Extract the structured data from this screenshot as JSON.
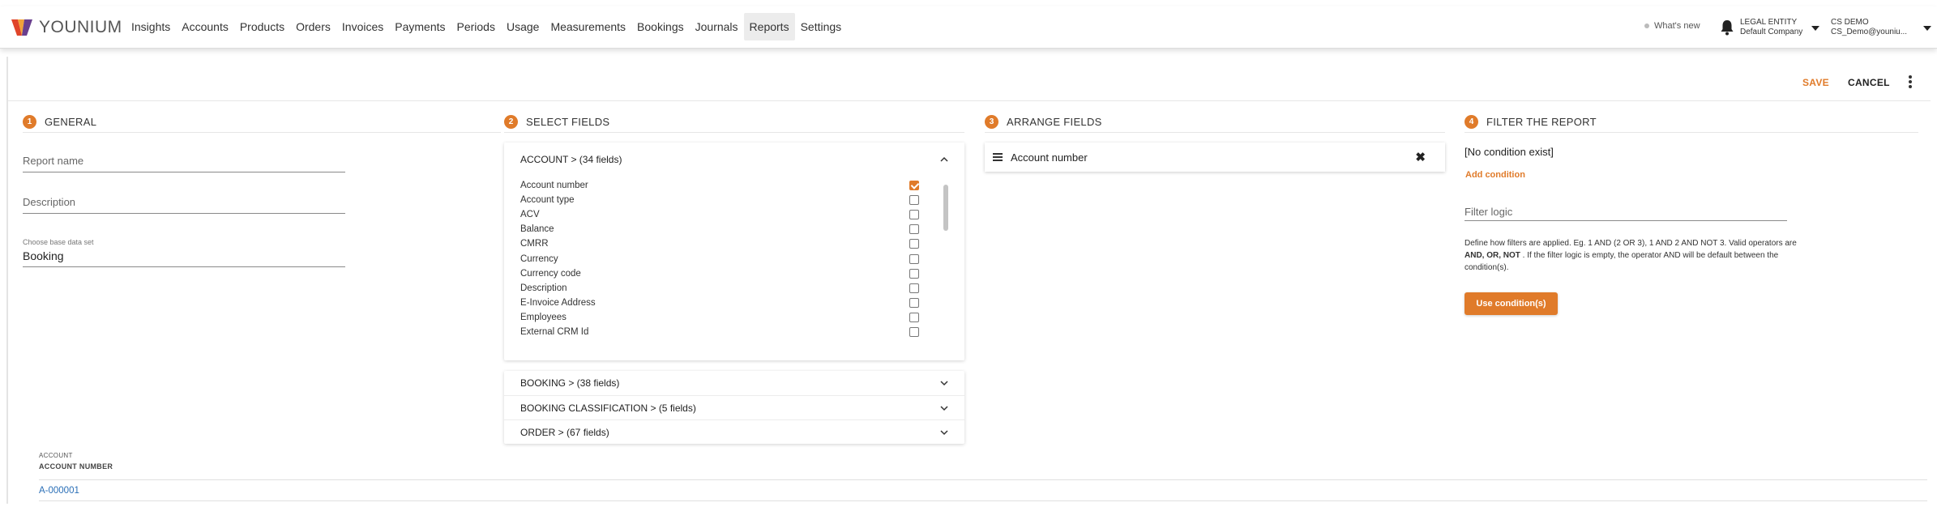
{
  "brand": {
    "logo_text": "YOUNIUM"
  },
  "nav": {
    "items": [
      "Insights",
      "Accounts",
      "Products",
      "Orders",
      "Invoices",
      "Payments",
      "Periods",
      "Usage",
      "Measurements",
      "Bookings",
      "Journals",
      "Reports",
      "Settings"
    ],
    "active": "Reports",
    "whats_new": "What's new",
    "legal_entity_label": "LEGAL ENTITY",
    "legal_entity_value": "Default Company",
    "user_name": "CS DEMO",
    "user_email": "CS_Demo@youniu..."
  },
  "toolbar": {
    "save_label": "SAVE",
    "cancel_label": "CANCEL"
  },
  "sections": {
    "general": {
      "step": "1",
      "title": "GENERAL"
    },
    "select": {
      "step": "2",
      "title": "SELECT FIELDS"
    },
    "arrange": {
      "step": "3",
      "title": "ARRANGE FIELDS"
    },
    "filter": {
      "step": "4",
      "title": "FILTER THE REPORT"
    }
  },
  "general": {
    "report_name_placeholder": "Report name",
    "description_placeholder": "Description",
    "base_data_set_label": "Choose base data set",
    "base_data_set_value": "Booking"
  },
  "select_fields": {
    "account_group": "ACCOUNT >  (34 fields)",
    "fields": [
      {
        "label": "Account number",
        "checked": true
      },
      {
        "label": "Account type",
        "checked": false
      },
      {
        "label": "ACV",
        "checked": false
      },
      {
        "label": "Balance",
        "checked": false
      },
      {
        "label": "CMRR",
        "checked": false
      },
      {
        "label": "Currency",
        "checked": false
      },
      {
        "label": "Currency code",
        "checked": false
      },
      {
        "label": "Description",
        "checked": false
      },
      {
        "label": "E-Invoice Address",
        "checked": false
      },
      {
        "label": "Employees",
        "checked": false
      },
      {
        "label": "External CRM Id",
        "checked": false
      }
    ],
    "collapsed_groups": [
      "BOOKING >  (38 fields)",
      "BOOKING CLASSIFICATION >  (5 fields)",
      "ORDER >  (67 fields)"
    ]
  },
  "arrange": {
    "items": [
      "Account number"
    ]
  },
  "filter": {
    "no_condition": "[No condition exist]",
    "add_condition": "Add condition",
    "filter_logic_placeholder": "Filter logic",
    "help_part1": "Define how filters are applied. Eg. 1 AND (2 OR 3), 1 AND 2 AND NOT 3. Valid operators are ",
    "help_bold": "AND, OR, NOT",
    "help_part2": " . If the filter logic is empty, the operator AND will be default between the condition(s).",
    "use_button": "Use condition(s)"
  },
  "preview": {
    "group": "ACCOUNT",
    "column": "ACCOUNT NUMBER",
    "rows": [
      "A-000001"
    ]
  },
  "colors": {
    "accent": "#e07b2a",
    "link": "#2a6fb7"
  },
  "icons": [
    "younium-logo-icon",
    "bell-icon",
    "caret-down-icon",
    "kebab-menu-icon",
    "chevron-up-icon",
    "chevron-down-icon",
    "drag-handle-icon",
    "close-icon",
    "checkbox-icon"
  ]
}
